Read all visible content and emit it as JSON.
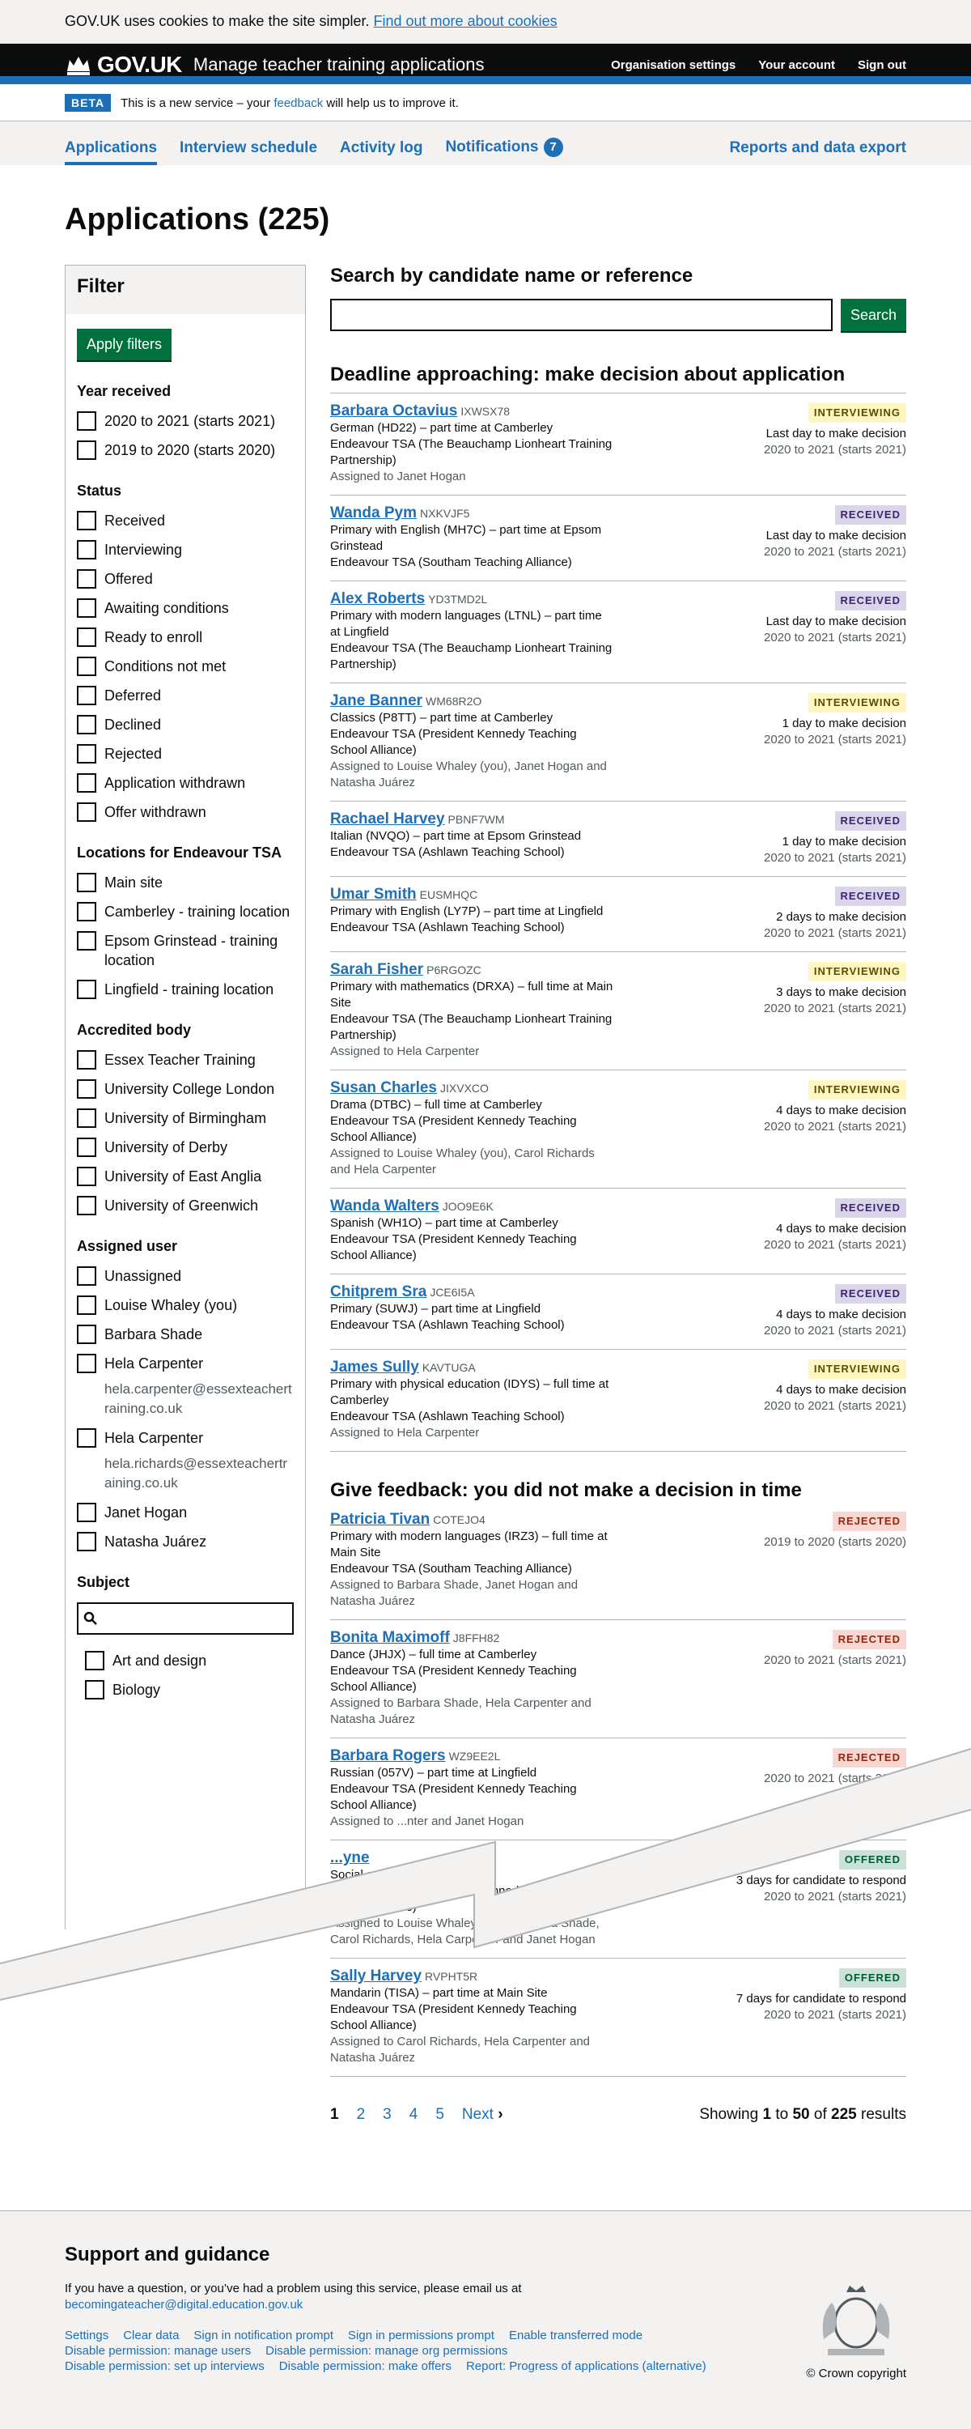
{
  "cookie": {
    "text": "GOV.UK uses cookies to make the site simpler.",
    "link": "Find out more about cookies"
  },
  "header": {
    "logo": "GOV.UK",
    "service": "Manage teacher training applications",
    "nav": [
      "Organisation settings",
      "Your account",
      "Sign out"
    ]
  },
  "phase": {
    "tag": "BETA",
    "text_before": "This is a new service – your",
    "link": "feedback",
    "text_after": "will help us to improve it."
  },
  "subnav": {
    "items": [
      "Applications",
      "Interview schedule",
      "Activity log",
      "Notifications"
    ],
    "notifications_count": "7",
    "right": "Reports and data export"
  },
  "page_title": "Applications (225)",
  "filter": {
    "title": "Filter",
    "apply": "Apply filters",
    "year": {
      "heading": "Year received",
      "options": [
        "2020 to 2021 (starts 2021)",
        "2019 to 2020 (starts 2020)"
      ]
    },
    "status": {
      "heading": "Status",
      "options": [
        "Received",
        "Interviewing",
        "Offered",
        "Awaiting conditions",
        "Ready to enroll",
        "Conditions not met",
        "Deferred",
        "Declined",
        "Rejected",
        "Application withdrawn",
        "Offer withdrawn"
      ]
    },
    "locations": {
      "heading": "Locations for Endeavour TSA",
      "options": [
        "Main site",
        "Camberley - training location",
        "Epsom Grinstead - training location",
        "Lingfield - training location"
      ]
    },
    "accredited": {
      "heading": "Accredited body",
      "options": [
        "Essex Teacher Training",
        "University College London",
        "University of Birmingham",
        "University of Derby",
        "University of East Anglia",
        "University of Greenwich"
      ]
    },
    "assigned": {
      "heading": "Assigned user",
      "options": [
        {
          "name": "Unassigned",
          "email": ""
        },
        {
          "name": "Louise Whaley (you)",
          "email": ""
        },
        {
          "name": "Barbara Shade",
          "email": ""
        },
        {
          "name": "Hela Carpenter",
          "email": "hela.carpenter@essexteachertraining.co.uk"
        },
        {
          "name": "Hela Carpenter",
          "email": "hela.richards@essexteachertraining.co.uk"
        },
        {
          "name": "Janet Hogan",
          "email": ""
        },
        {
          "name": "Natasha Juárez",
          "email": ""
        }
      ]
    },
    "subject": {
      "heading": "Subject",
      "options": [
        "Art and design",
        "Biology"
      ]
    }
  },
  "search": {
    "heading": "Search by candidate name or reference",
    "button": "Search"
  },
  "section1": {
    "heading": "Deadline approaching: make decision about application",
    "cards": [
      {
        "name": "Barbara Octavius",
        "ref": "IXWSX78",
        "course": "German (HD22) – part time at Camberley",
        "provider": "Endeavour TSA (The Beauchamp Lionheart Training Partnership)",
        "assigned": "Assigned to Janet Hogan",
        "status": "INTERVIEWING",
        "deadline": "Last day to make decision",
        "cycle": "2020 to 2021 (starts 2021)"
      },
      {
        "name": "Wanda Pym",
        "ref": "NXKVJF5",
        "course": "Primary with English (MH7C) – part time at Epsom Grinstead",
        "provider": "Endeavour TSA (Southam Teaching Alliance)",
        "assigned": "",
        "status": "RECEIVED",
        "deadline": "Last day to make decision",
        "cycle": "2020 to 2021 (starts 2021)"
      },
      {
        "name": "Alex Roberts",
        "ref": "YD3TMD2L",
        "course": "Primary with modern languages (LTNL) – part time at Lingfield",
        "provider": "Endeavour TSA (The Beauchamp Lionheart Training Partnership)",
        "assigned": "",
        "status": "RECEIVED",
        "deadline": "Last day to make decision",
        "cycle": "2020 to 2021 (starts 2021)"
      },
      {
        "name": "Jane Banner",
        "ref": "WM68R2O",
        "course": "Classics (P8TT) – part time at Camberley",
        "provider": "Endeavour TSA (President Kennedy Teaching School Alliance)",
        "assigned": "Assigned to Louise Whaley (you), Janet Hogan and Natasha Juárez",
        "status": "INTERVIEWING",
        "deadline": "1 day to make decision",
        "cycle": "2020 to 2021 (starts 2021)"
      },
      {
        "name": "Rachael Harvey",
        "ref": "PBNF7WM",
        "course": "Italian (NVQO) – part time at Epsom Grinstead",
        "provider": "Endeavour TSA (Ashlawn Teaching School)",
        "assigned": "",
        "status": "RECEIVED",
        "deadline": "1 day to make decision",
        "cycle": "2020 to 2021 (starts 2021)"
      },
      {
        "name": "Umar Smith",
        "ref": "EUSMHQC",
        "course": "Primary with English (LY7P) – part time at Lingfield",
        "provider": "Endeavour TSA (Ashlawn Teaching School)",
        "assigned": "",
        "status": "RECEIVED",
        "deadline": "2 days to make decision",
        "cycle": "2020 to 2021 (starts 2021)"
      },
      {
        "name": "Sarah Fisher",
        "ref": "P6RGOZC",
        "course": "Primary with mathematics (DRXA) – full time at Main Site",
        "provider": "Endeavour TSA (The Beauchamp Lionheart Training Partnership)",
        "assigned": "Assigned to Hela Carpenter",
        "status": "INTERVIEWING",
        "deadline": "3 days to make decision",
        "cycle": "2020 to 2021 (starts 2021)"
      },
      {
        "name": "Susan Charles",
        "ref": "JIXVXCO",
        "course": "Drama (DTBC) – full time at Camberley",
        "provider": "Endeavour TSA (President Kennedy Teaching School Alliance)",
        "assigned": "Assigned to Louise Whaley (you), Carol Richards and Hela Carpenter",
        "status": "INTERVIEWING",
        "deadline": "4 days to make decision",
        "cycle": "2020 to 2021 (starts 2021)"
      },
      {
        "name": "Wanda Walters",
        "ref": "JOO9E6K",
        "course": "Spanish (WH1O) – part time at Camberley",
        "provider": "Endeavour TSA (President Kennedy Teaching School Alliance)",
        "assigned": "",
        "status": "RECEIVED",
        "deadline": "4 days to make decision",
        "cycle": "2020 to 2021 (starts 2021)"
      },
      {
        "name": "Chitprem Sra",
        "ref": "JCE6I5A",
        "course": "Primary (SUWJ) – part time at Lingfield",
        "provider": "Endeavour TSA (Ashlawn Teaching School)",
        "assigned": "",
        "status": "RECEIVED",
        "deadline": "4 days to make decision",
        "cycle": "2020 to 2021 (starts 2021)"
      },
      {
        "name": "James Sully",
        "ref": "KAVTUGA",
        "course": "Primary with physical education (IDYS) – full time at Camberley",
        "provider": "Endeavour TSA (Ashlawn Teaching School)",
        "assigned": "Assigned to Hela Carpenter",
        "status": "INTERVIEWING",
        "deadline": "4 days to make decision",
        "cycle": "2020 to 2021 (starts 2021)"
      }
    ]
  },
  "section2": {
    "heading": "Give feedback: you did not make a decision in time",
    "cards": [
      {
        "name": "Patricia Tivan",
        "ref": "COTEJO4",
        "course": "Primary with modern languages (IRZ3) – full time at Main Site",
        "provider": "Endeavour TSA (Southam Teaching Alliance)",
        "assigned": "Assigned to Barbara Shade, Janet Hogan and Natasha Juárez",
        "status": "REJECTED",
        "deadline": "",
        "cycle": "2019 to 2020 (starts 2020)"
      },
      {
        "name": "Bonita Maximoff",
        "ref": "J8FFH82",
        "course": "Dance (JHJX) – full time at Camberley",
        "provider": "Endeavour TSA (President Kennedy Teaching School Alliance)",
        "assigned": "Assigned to Barbara Shade, Hela Carpenter and Natasha Juárez",
        "status": "REJECTED",
        "deadline": "",
        "cycle": "2020 to 2021 (starts 2021)"
      },
      {
        "name": "Barbara Rogers",
        "ref": "WZ9EE2L",
        "course": "Russian (057V) – part time at Lingfield",
        "provider": "Endeavour TSA (President Kennedy Teaching School Alliance)",
        "assigned": "Assigned to ...nter and Janet Hogan",
        "status": "REJECTED",
        "deadline": "",
        "cycle": "2020 to 2021 (starts 2021)"
      },
      {
        "name": "...yne",
        "ref": "",
        "course": "Social sciences (O...",
        "provider": "Endeavour TSA (President Kennedy Teaching School Alliance)",
        "assigned": "Assigned to Louise Whaley (you), Barbara Shade, Carol Richards, Hela Carpenter and Janet Hogan",
        "status": "OFFERED",
        "deadline": "3 days for candidate to respond",
        "cycle": "2020 to 2021 (starts 2021)"
      },
      {
        "name": "Sally Harvey",
        "ref": "RVPHT5R",
        "course": "Mandarin (TISA) – part time at Main Site",
        "provider": "Endeavour TSA (President Kennedy Teaching School Alliance)",
        "assigned": "Assigned to Carol Richards, Hela Carpenter and Natasha Juárez",
        "status": "OFFERED",
        "deadline": "7 days for candidate to respond",
        "cycle": "2020 to 2021 (starts 2021)"
      }
    ]
  },
  "pagination": {
    "pages": [
      "1",
      "2",
      "3",
      "4",
      "5"
    ],
    "next": "Next",
    "showing": "Showing",
    "from": "1",
    "to_word": "to",
    "to": "50",
    "of_word": "of",
    "total": "225",
    "results": "results"
  },
  "footer": {
    "heading": "Support and guidance",
    "text": "If you have a question, or you’ve had a problem using this service, please email us at",
    "email": "becomingateacher@digital.education.gov.uk",
    "links": [
      "Settings",
      "Clear data",
      "Sign in notification prompt",
      "Sign in permissions prompt",
      "Enable transferred mode",
      "Disable permission: manage users",
      "Disable permission: manage org permissions",
      "Disable permission: set up interviews",
      "Disable permission: make offers",
      "Report: Progress of applications (alternative)"
    ],
    "copyright": "© Crown copyright"
  },
  "colors": {
    "link": "#1d70b8",
    "header": "#0b0c0c",
    "button": "#00703c",
    "panel": "#f3f2f1"
  }
}
